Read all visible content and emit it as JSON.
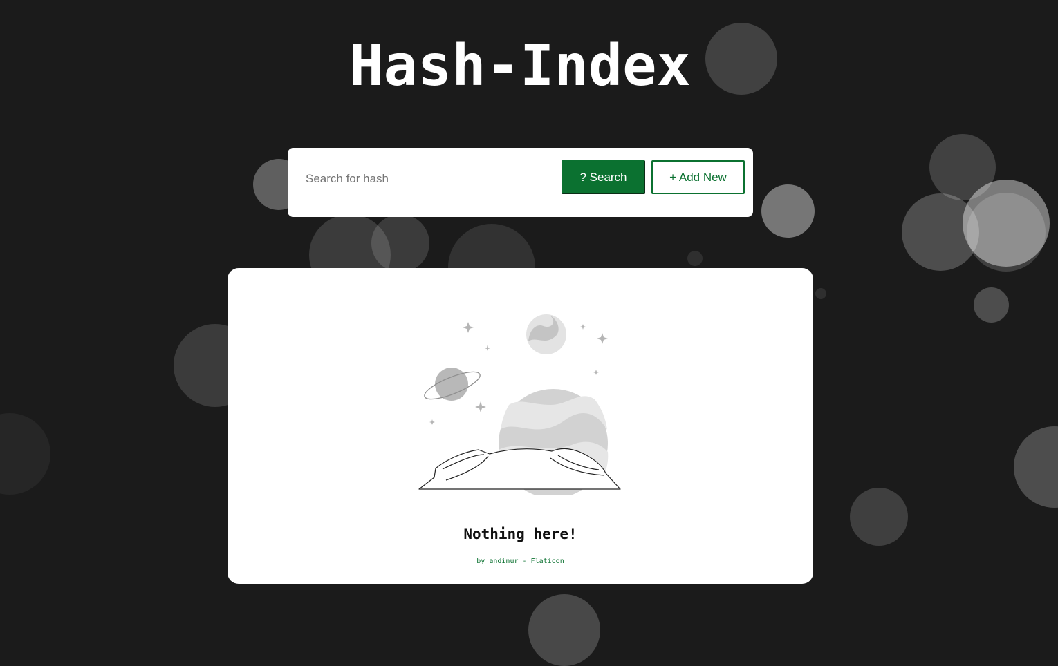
{
  "app": {
    "title": "Hash-Index"
  },
  "search": {
    "placeholder": "Search for hash",
    "value": "",
    "search_button_label": "? Search",
    "add_button_label": "+ Add New"
  },
  "empty_state": {
    "title": "Nothing here!",
    "credit_text": "by andinur - Flaticon",
    "illustration_icon": "space-planets-illustration"
  },
  "colors": {
    "background": "#1b1b1b",
    "accent": "#0b7130",
    "panel": "#ffffff"
  }
}
